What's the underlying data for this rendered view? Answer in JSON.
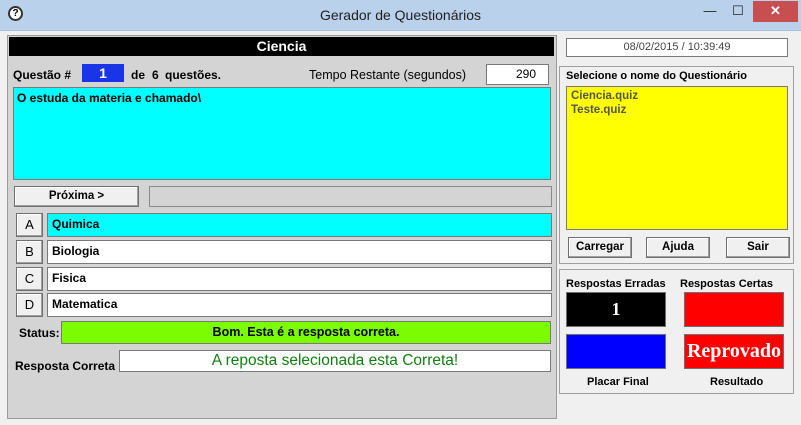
{
  "window": {
    "title": "Gerador de Questionários",
    "min_glyph": "—",
    "max_glyph": "☐",
    "close_glyph": "✕"
  },
  "quiz": {
    "title": "Ciencia",
    "question_label": "Questão #",
    "question_number": "1",
    "of_text": "de",
    "total_questions": "6",
    "questions_text": "questões.",
    "time_label": "Tempo Restante (segundos)",
    "time_remaining": "290",
    "question_text": "O estuda da materia e chamado\\",
    "next_label": "Próxima >",
    "progress": 0
  },
  "options": [
    {
      "letter": "A",
      "text": "Quimica",
      "selected": true
    },
    {
      "letter": "B",
      "text": "Biologia",
      "selected": false
    },
    {
      "letter": "C",
      "text": "Fisica",
      "selected": false
    },
    {
      "letter": "D",
      "text": "Matematica",
      "selected": false
    }
  ],
  "status": {
    "label": "Status:",
    "text": "Bom. Esta é a resposta correta.",
    "color": "#7cfc00"
  },
  "correct_answer": {
    "label": "Resposta Correta",
    "text": "A reposta selecionada esta Correta!",
    "color": "#108010"
  },
  "sidebar": {
    "datetime": "08/02/2015 / 10:39:49",
    "list_label": "Selecione o nome do Questionário",
    "files": [
      "Ciencia.quiz",
      "Teste.quiz"
    ],
    "buttons": {
      "load": "Carregar",
      "help": "Ajuda",
      "exit": "Sair"
    },
    "wrong_label": "Respostas Erradas",
    "right_label": "Respostas Certas",
    "wrong_count": "1",
    "final_label": "Placar Final",
    "result_label": "Resultado",
    "result_text": "Reprovado"
  },
  "colors": {
    "question_bg": "#00ffff",
    "list_bg": "#ffff00",
    "qnum_bg": "#1a34e8",
    "wrong_bg": "#000000",
    "right_bg": "#ff0000",
    "final_bg": "#0000ff",
    "result_bg": "#ff0000"
  }
}
